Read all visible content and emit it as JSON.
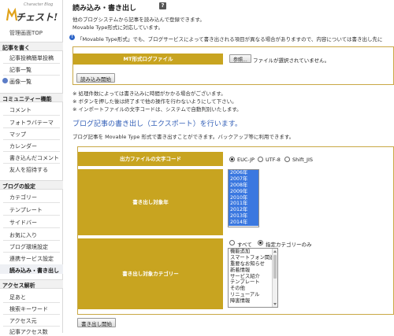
{
  "sidebar": {
    "logo_text": "チェスト!",
    "logo_small": "Character Blog",
    "admin_top": "管理画面TOP",
    "sections": [
      {
        "title": "記事を書く",
        "items": [
          "記事投稿",
          "簡単投稿",
          "記事一覧",
          "画像一覧"
        ]
      },
      {
        "title": "コミュニティー機能",
        "items": [
          "コメント",
          "フォトラバテーマ",
          "マップ",
          "カレンダー",
          "書き込んだコメント",
          "友人を招待する"
        ]
      },
      {
        "title": "ブログの設定",
        "items": [
          "カテゴリー",
          "テンプレート",
          "サイドバー",
          "お気に入り",
          "ブログ環境設定",
          "連携サービス設定",
          "読み込み・書き出し"
        ]
      },
      {
        "title": "アクセス解析",
        "items": [
          "足あと",
          "検索キーワード",
          "アクセス元",
          "記事アクセス数"
        ]
      }
    ]
  },
  "main": {
    "title": "読み込み・書き出し",
    "help_icon": "?",
    "desc1": "他のブログシステムから記事を読み込んで登録できます。",
    "desc2": "Movable Type形式に対応しています。",
    "info": "「Movable Type形式」でも、ブログサービスによって書き出される項目が異なる場合がありますので、内容については書き出し先に",
    "import": {
      "label": "MT形式ログファイル",
      "browse": "参照...",
      "no_file": "ファイルが選択されていません。",
      "start": "読み込み開始"
    },
    "notes": [
      "※ 処理件数によっては書き込みに時間がかかる場合がございます。",
      "※ ボタンを押した後は終了まで他の操作を行わないようにして下さい。",
      "※ インポートファイルの文字コードは、システムで自動判別いたします。"
    ],
    "export": {
      "title": "ブログ記事の書き出し（エクスポート）を行います。",
      "desc": "ブログ記事を Movable Type 形式で書き出すことができます。バックアップ等に利用できます。",
      "encoding_label": "出力ファイルの文字コード",
      "encodings": [
        "EUC-JP",
        "UTF-8",
        "Shift_JIS"
      ],
      "selected_encoding": "EUC-JP",
      "year_label": "書き出し対象年",
      "years": [
        "2006年",
        "2007年",
        "2008年",
        "2009年",
        "2010年",
        "2011年",
        "2012年",
        "2013年",
        "2014年"
      ],
      "category_label": "書き出し対象カテゴリー",
      "category_modes": [
        "すべて",
        "指定カテゴリーのみ"
      ],
      "selected_mode": "指定カテゴリーのみ",
      "categories": [
        "機能追加",
        "スマートフォン関連",
        "重要なお知らせ",
        "新着情報",
        "サービス紹介",
        "テンプレート",
        "その他",
        "リニューアル",
        "障害情報"
      ],
      "start": "書き出し開始"
    }
  },
  "colors": {
    "gold": "#c8a420",
    "accent_blue": "#3561b8",
    "select_blue": "#3b78e0"
  }
}
